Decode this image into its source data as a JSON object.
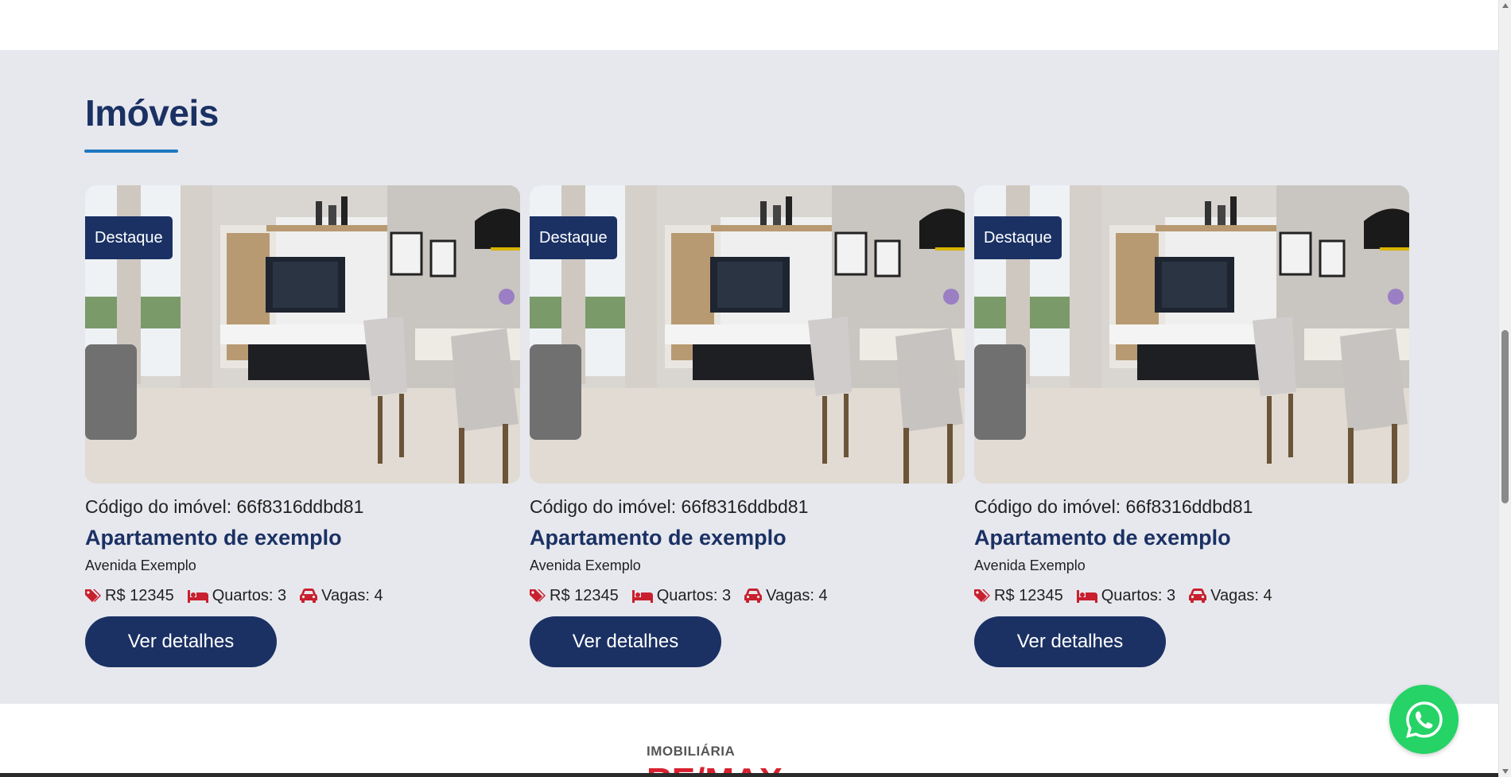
{
  "section": {
    "title": "Imóveis"
  },
  "cards": [
    {
      "badge": "Destaque",
      "code": "Código do imóvel: 66f8316ddbd81",
      "title": "Apartamento de exemplo",
      "address": "Avenida Exemplo",
      "price": "R$ 12345",
      "rooms": "Quartos: 3",
      "parking": "Vagas: 4",
      "button": "Ver detalhes"
    },
    {
      "badge": "Destaque",
      "code": "Código do imóvel: 66f8316ddbd81",
      "title": "Apartamento de exemplo",
      "address": "Avenida Exemplo",
      "price": "R$ 12345",
      "rooms": "Quartos: 3",
      "parking": "Vagas: 4",
      "button": "Ver detalhes"
    },
    {
      "badge": "Destaque",
      "code": "Código do imóvel: 66f8316ddbd81",
      "title": "Apartamento de exemplo",
      "address": "Avenida Exemplo",
      "price": "R$ 12345",
      "rooms": "Quartos: 3",
      "parking": "Vagas: 4",
      "button": "Ver detalhes"
    }
  ],
  "footer": {
    "logo_top": "IMOBILIÁRIA",
    "logo_brand": "RE/MAX"
  },
  "icons": {
    "price": "tag-icon",
    "rooms": "bed-icon",
    "parking": "car-icon",
    "whatsapp": "whatsapp-icon"
  },
  "colors": {
    "primary": "#1b3164",
    "accent_line": "#1f77c0",
    "icon_red": "#c8202e",
    "section_bg": "#e7e8ee",
    "whatsapp": "#25d366"
  }
}
